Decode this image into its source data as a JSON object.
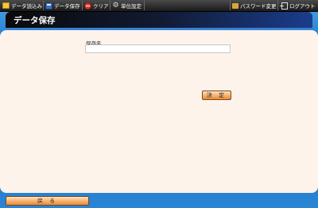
{
  "toolbar": {
    "load_label": "データ読込み",
    "save_label": "データ保存",
    "clear_label": "クリア",
    "units_label": "単位設定",
    "password_label": "パスワード変更",
    "logout_label": "ログアウト"
  },
  "page": {
    "title": "データ保存"
  },
  "form": {
    "save_name_label": "保存名",
    "save_name_value": "",
    "submit_label": "決 定"
  },
  "footer": {
    "back_label": "戻 る"
  },
  "colors": {
    "accent_orange": "#f7b06a",
    "panel_bg": "#fdf3ea",
    "frame_blue": "#2b86d6"
  }
}
